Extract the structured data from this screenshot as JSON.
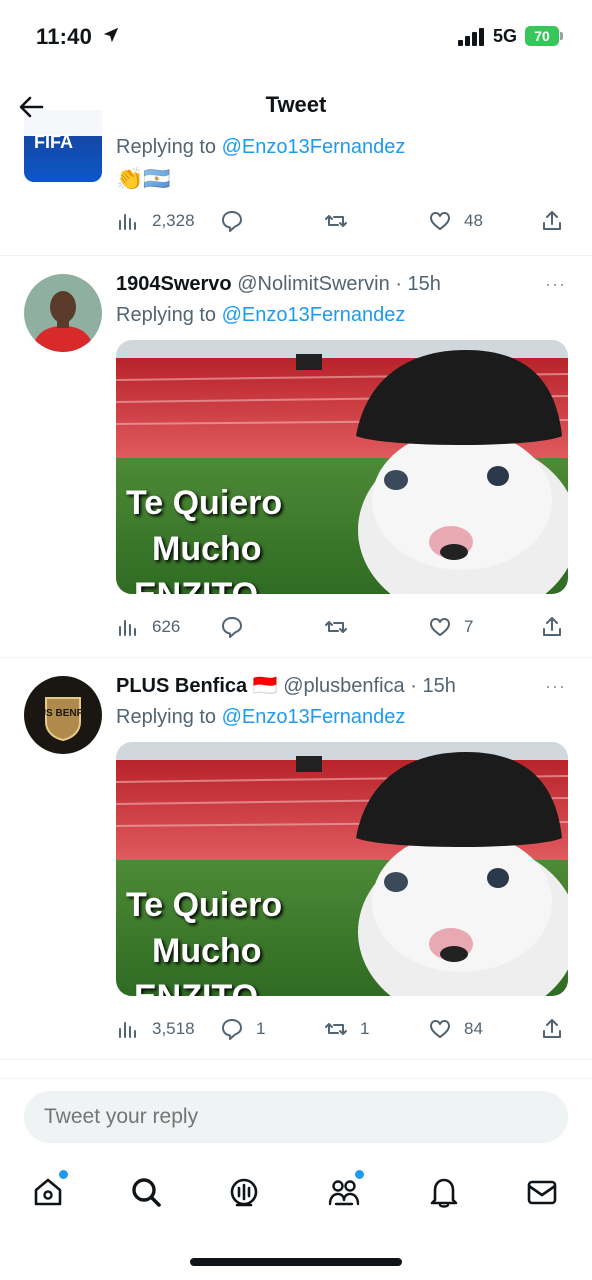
{
  "status_bar": {
    "time": "11:40",
    "network": "5G",
    "battery": "70"
  },
  "header": {
    "title": "Tweet"
  },
  "tweets": [
    {
      "avatar_label": "FIFA",
      "replying_prefix": "Replying to ",
      "replying_to": "@Enzo13Fernandez",
      "text": "👏🇦🇷",
      "stats": {
        "views": "2,328",
        "replies": "",
        "retweets": "",
        "likes": "48"
      }
    },
    {
      "name": "1904Swervo",
      "handle": "@NolimitSwervin",
      "time": "· 15h",
      "more": "···",
      "replying_prefix": "Replying to ",
      "replying_to": "@Enzo13Fernandez",
      "media_text": [
        "Te Quiero",
        "Mucho",
        "ENZITO"
      ],
      "stats": {
        "views": "626",
        "replies": "",
        "retweets": "",
        "likes": "7"
      }
    },
    {
      "name": "PLUS Benfica",
      "flag": "🇮🇩",
      "handle": "@plusbenfica",
      "time": "· 15h",
      "more": "···",
      "avatar_label": "PLUS BENFICA",
      "replying_prefix": "Replying to ",
      "replying_to": "@Enzo13Fernandez",
      "media_text": [
        "Te Quiero",
        "Mucho",
        "ENZITO"
      ],
      "stats": {
        "views": "3,518",
        "replies": "1",
        "retweets": "1",
        "likes": "84"
      }
    }
  ],
  "composer": {
    "placeholder": "Tweet your reply"
  },
  "tabbar": {
    "items": [
      "home-icon",
      "search-icon",
      "spaces-icon",
      "communities-icon",
      "notifications-icon",
      "messages-icon"
    ]
  },
  "colors": {
    "accent": "#1d9bf0",
    "muted": "#536471",
    "text": "#0f1419"
  }
}
